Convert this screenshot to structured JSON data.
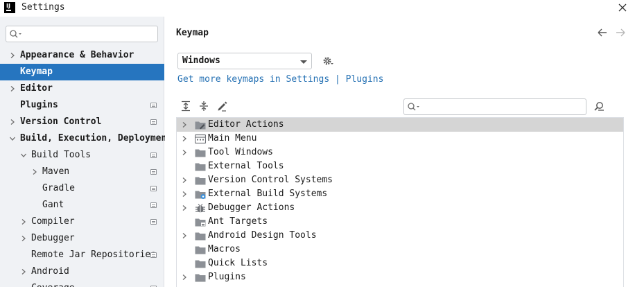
{
  "window": {
    "logo_text": "IJ",
    "title": "Settings"
  },
  "sidebar": {
    "search_placeholder": "",
    "items": [
      {
        "label": "Appearance & Behavior",
        "level": 0,
        "chevron": "right",
        "bold": true,
        "selected": false,
        "project": false
      },
      {
        "label": "Keymap",
        "level": 0,
        "chevron": "none",
        "bold": true,
        "selected": true,
        "project": false
      },
      {
        "label": "Editor",
        "level": 0,
        "chevron": "right",
        "bold": true,
        "selected": false,
        "project": false
      },
      {
        "label": "Plugins",
        "level": 0,
        "chevron": "none",
        "bold": true,
        "selected": false,
        "project": true
      },
      {
        "label": "Version Control",
        "level": 0,
        "chevron": "right",
        "bold": true,
        "selected": false,
        "project": true
      },
      {
        "label": "Build, Execution, Deployment",
        "level": 0,
        "chevron": "down",
        "bold": true,
        "selected": false,
        "project": false
      },
      {
        "label": "Build Tools",
        "level": 1,
        "chevron": "down",
        "bold": false,
        "selected": false,
        "project": true
      },
      {
        "label": "Maven",
        "level": 2,
        "chevron": "right",
        "bold": false,
        "selected": false,
        "project": true
      },
      {
        "label": "Gradle",
        "level": 2,
        "chevron": "none",
        "bold": false,
        "selected": false,
        "project": true
      },
      {
        "label": "Gant",
        "level": 2,
        "chevron": "none",
        "bold": false,
        "selected": false,
        "project": true
      },
      {
        "label": "Compiler",
        "level": 1,
        "chevron": "right",
        "bold": false,
        "selected": false,
        "project": true
      },
      {
        "label": "Debugger",
        "level": 1,
        "chevron": "right",
        "bold": false,
        "selected": false,
        "project": false
      },
      {
        "label": "Remote Jar Repositories",
        "level": 1,
        "chevron": "none",
        "bold": false,
        "selected": false,
        "project": true
      },
      {
        "label": "Android",
        "level": 1,
        "chevron": "right",
        "bold": false,
        "selected": false,
        "project": false
      },
      {
        "label": "Coverage",
        "level": 1,
        "chevron": "none",
        "bold": false,
        "selected": false,
        "project": true
      }
    ]
  },
  "main": {
    "title": "Keymap",
    "keymap_value": "Windows",
    "link_settings": "Get more keymaps in Settings",
    "link_separator": "|",
    "link_plugins": "Plugins",
    "filter_placeholder": "",
    "toolbar_icons": [
      "expand-all-icon",
      "collapse-all-icon",
      "edit-shortcut-icon"
    ],
    "actions": [
      {
        "label": "Editor Actions",
        "chevron": true,
        "icon": "editor-folder-icon",
        "highlighted": true
      },
      {
        "label": "Main Menu",
        "chevron": true,
        "icon": "menu-icon",
        "highlighted": false
      },
      {
        "label": "Tool Windows",
        "chevron": true,
        "icon": "folder-icon",
        "highlighted": false
      },
      {
        "label": "External Tools",
        "chevron": false,
        "icon": "folder-icon",
        "highlighted": false
      },
      {
        "label": "Version Control Systems",
        "chevron": true,
        "icon": "folder-icon",
        "highlighted": false
      },
      {
        "label": "External Build Systems",
        "chevron": true,
        "icon": "build-folder-icon",
        "highlighted": false
      },
      {
        "label": "Debugger Actions",
        "chevron": true,
        "icon": "bug-icon",
        "highlighted": false
      },
      {
        "label": "Ant Targets",
        "chevron": false,
        "icon": "ant-folder-icon",
        "highlighted": false
      },
      {
        "label": "Android Design Tools",
        "chevron": true,
        "icon": "folder-icon",
        "highlighted": false
      },
      {
        "label": "Macros",
        "chevron": false,
        "icon": "folder-icon",
        "highlighted": false
      },
      {
        "label": "Quick Lists",
        "chevron": false,
        "icon": "folder-icon",
        "highlighted": false
      },
      {
        "label": "Plugins",
        "chevron": true,
        "icon": "folder-icon",
        "highlighted": false
      }
    ]
  },
  "colors": {
    "accent": "#2675bf",
    "link": "#2470b3",
    "sidebar_bg": "#f0f2f5",
    "highlight_row": "#d5d5d5"
  }
}
